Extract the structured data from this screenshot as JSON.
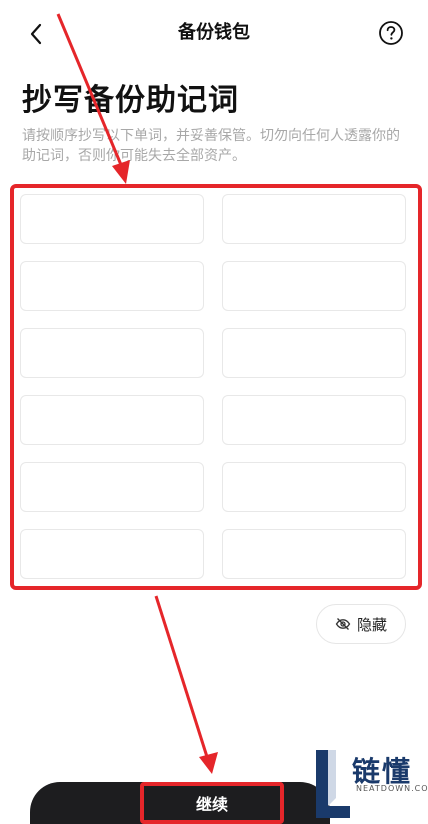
{
  "nav": {
    "title": "备份钱包"
  },
  "page": {
    "heading": "抄写备份助记词",
    "description": "请按顺序抄写以下单词，并妥善保管。切勿向任何人透露你的助记词，否则你可能失去全部资产。"
  },
  "words": [
    "",
    "",
    "",
    "",
    "",
    "",
    "",
    "",
    "",
    "",
    "",
    ""
  ],
  "hide_button": {
    "label": "隐藏",
    "icon": "eye-off-icon"
  },
  "continue_button": {
    "label": "继续"
  },
  "watermark": {
    "text": "链懂",
    "sub": "NEATDOWN.COM"
  },
  "colors": {
    "annotation": "#e5262a",
    "button_bg": "#1d1d1f",
    "watermark": "#1a3a6b"
  }
}
